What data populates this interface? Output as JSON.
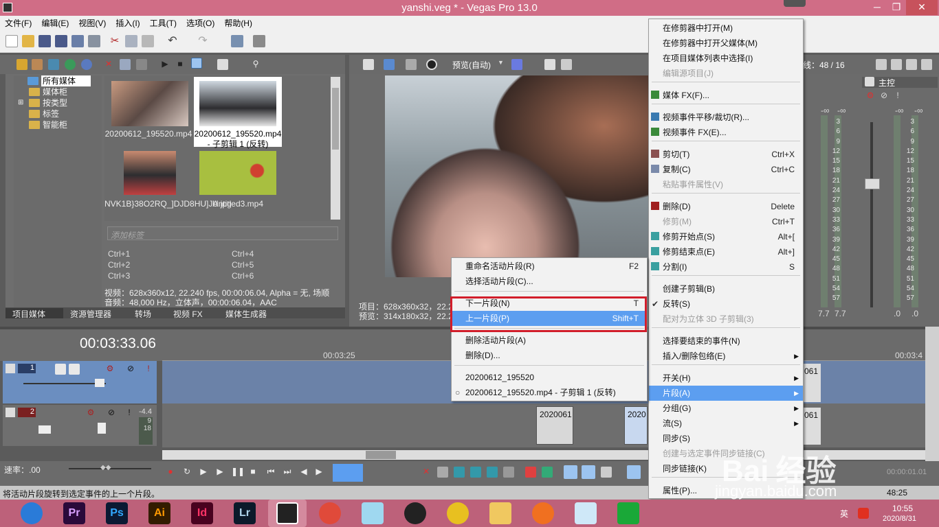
{
  "window": {
    "title": "yanshi.veg * - Vegas Pro 13.0"
  },
  "menubar": [
    "文件(F)",
    "编辑(E)",
    "视图(V)",
    "插入(I)",
    "工具(T)",
    "选项(O)",
    "帮助(H)"
  ],
  "tree": [
    "所有媒体",
    "媒体柜",
    "按类型",
    "标签",
    "智能柜"
  ],
  "media": [
    {
      "name": "20200612_195520.mp4"
    },
    {
      "name": "20200612_195520.mp4 - 子剪辑 1 (反转)"
    },
    {
      "name": "NVK1B}38O2RQ_]DJD8HU]JA.jpg"
    },
    {
      "name": "Untitled3.mp4"
    }
  ],
  "tag_placeholder": "添加标签",
  "shortcuts": [
    "Ctrl+1",
    "Ctrl+4",
    "Ctrl+2",
    "Ctrl+5",
    "Ctrl+3",
    "Ctrl+6"
  ],
  "media_info": {
    "video": "视频：628x360x12, 22.240 fps, 00:00:06.04, Alpha = 无, 场顺",
    "audio": "音频：48,000 Hz，立体声，00:00:06.04，AAC"
  },
  "panel_tabs": [
    "项目媒体",
    "资源管理器",
    "转场",
    "视频 FX",
    "媒体生成器"
  ],
  "preview": {
    "mode": "预览(自动)",
    "project": "项目：628x360x32，22.2",
    "preview": "预览：314x180x32，22.2",
    "frame": "线：48 / 16"
  },
  "mixer": {
    "label": "主控",
    "top_left": "-∞",
    "top_right": "-∞",
    "scale": [
      "3",
      "6",
      "9",
      "12",
      "15",
      "18",
      "21",
      "24",
      "27",
      "30",
      "33",
      "36",
      "39",
      "42",
      "45",
      "48",
      "51",
      "54",
      "57"
    ],
    "bottom": [
      "7.7",
      "7.7",
      ".0",
      ".0"
    ]
  },
  "timeline": {
    "timecode": "00:03:33.06",
    "ruler_1": "00:03:25",
    "ruler_2": "00:03:4",
    "track1_num": "1",
    "track2_num": "2",
    "track2_vol": "-4.4",
    "track2_peak1": "9",
    "track2_peak2": "18",
    "clip1": "2020061",
    "clip2": "2020",
    "clip3": "061",
    "clip4": "061",
    "rate_label": "速率：.00",
    "end_time": "00:00:01.01",
    "end_time2": "48:25"
  },
  "status_bar": "将活动片段旋转到选定事件的上一个片段。",
  "ctx_main": [
    {
      "label": "在修剪器中打开(M)",
      "shortcut": "",
      "disabled": false
    },
    {
      "label": "在修剪器中打开父媒体(M)",
      "shortcut": "",
      "disabled": false
    },
    {
      "label": "在项目媒体列表中选择(I)",
      "shortcut": "",
      "disabled": false
    },
    {
      "label": "编辑源项目(J)",
      "shortcut": "",
      "disabled": true
    },
    {
      "label": "媒体 FX(F)...",
      "shortcut": "",
      "disabled": false
    },
    {
      "label": "视频事件平移/裁切(R)...",
      "shortcut": "",
      "disabled": false
    },
    {
      "label": "视频事件 FX(E)...",
      "shortcut": "",
      "disabled": false
    },
    {
      "label": "剪切(T)",
      "shortcut": "Ctrl+X",
      "disabled": false
    },
    {
      "label": "复制(C)",
      "shortcut": "Ctrl+C",
      "disabled": false
    },
    {
      "label": "粘贴事件属性(V)",
      "shortcut": "",
      "disabled": true
    },
    {
      "label": "删除(D)",
      "shortcut": "Delete",
      "disabled": false
    },
    {
      "label": "修剪(M)",
      "shortcut": "Ctrl+T",
      "disabled": true
    },
    {
      "label": "修剪开始点(S)",
      "shortcut": "Alt+[",
      "disabled": false
    },
    {
      "label": "修剪结束点(E)",
      "shortcut": "Alt+]",
      "disabled": false
    },
    {
      "label": "分割(I)",
      "shortcut": "S",
      "disabled": false
    },
    {
      "label": "创建子剪辑(B)",
      "shortcut": "",
      "disabled": false
    },
    {
      "label": "反转(S)",
      "shortcut": "",
      "disabled": false
    },
    {
      "label": "配对为立体 3D 子剪辑(3)",
      "shortcut": "",
      "disabled": true
    },
    {
      "label": "选择要结束的事件(N)",
      "shortcut": "",
      "disabled": false
    },
    {
      "label": "插入/删除包络(E)",
      "shortcut": "",
      "disabled": false
    },
    {
      "label": "开关(H)",
      "shortcut": "",
      "disabled": false
    },
    {
      "label": "片段(A)",
      "shortcut": "",
      "disabled": false
    },
    {
      "label": "分组(G)",
      "shortcut": "",
      "disabled": false
    },
    {
      "label": "流(S)",
      "shortcut": "",
      "disabled": false
    },
    {
      "label": "同步(S)",
      "shortcut": "",
      "disabled": false
    },
    {
      "label": "创建与选定事件同步链接(C)",
      "shortcut": "",
      "disabled": true
    },
    {
      "label": "同步链接(K)",
      "shortcut": "",
      "disabled": false
    },
    {
      "label": "属性(P)...",
      "shortcut": "",
      "disabled": false
    }
  ],
  "ctx_sub": [
    {
      "label": "重命名活动片段(R)",
      "shortcut": "F2"
    },
    {
      "label": "选择活动片段(C)...",
      "shortcut": ""
    },
    {
      "label": "下一片段(N)",
      "shortcut": "T"
    },
    {
      "label": "上一片段(P)",
      "shortcut": "Shift+T"
    },
    {
      "label": "删除活动片段(A)",
      "shortcut": ""
    },
    {
      "label": "删除(D)...",
      "shortcut": ""
    },
    {
      "label": "20200612_195520",
      "shortcut": ""
    },
    {
      "label": "20200612_195520.mp4 - 子剪辑 1 (反转)",
      "shortcut": ""
    }
  ],
  "taskbar": {
    "apps": [
      "Pr",
      "Ps",
      "Ai",
      "Id",
      "Lr"
    ],
    "time": "10:55",
    "date": "2020/8/31",
    "ime": "英"
  },
  "watermark": {
    "brand": "Bai",
    "brand2": "经验",
    "url": "jingyan.baidu.com"
  },
  "colors": {
    "title": "#d06d86",
    "highlight": "#5c9ef0",
    "red_box": "#d21d2a",
    "taskbar": "#bd617a"
  }
}
